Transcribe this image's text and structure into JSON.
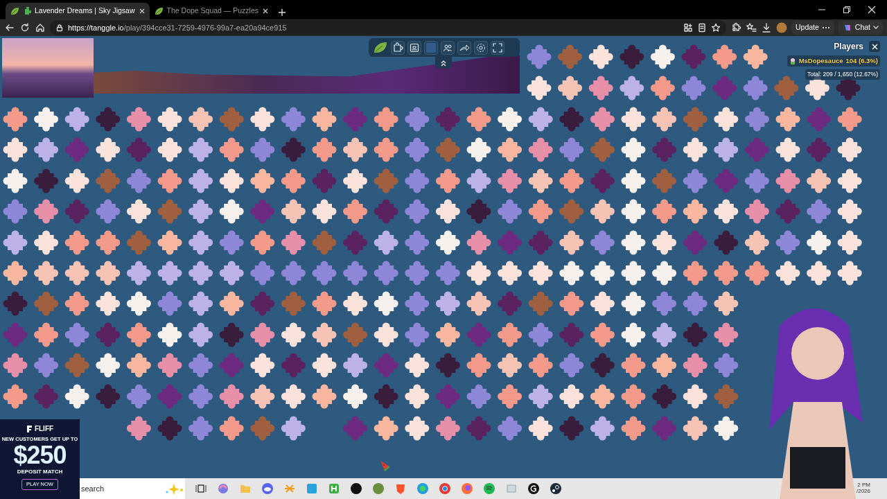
{
  "browser": {
    "tabs": [
      {
        "title": "Lavender Dreams | Sky Jigsaw",
        "selected": true
      },
      {
        "title": "The Dope Squad — Puzzles",
        "selected": false
      }
    ],
    "url_host": "https://tanggle.io",
    "url_path": "/play/394cce31-7259-4976-99a7-ea20a94ce915",
    "update_button": "Update",
    "chat_button": "Chat"
  },
  "players_panel": {
    "title": "Players",
    "players": [
      {
        "name": "MsDopesauce",
        "score": "104 (6.3%)"
      }
    ],
    "total": "Total: 209 / 1,650 (12.67%)"
  },
  "ad": {
    "brand": "FLIFF",
    "tagline": "NEW CUSTOMERS GET UP TO",
    "amount": "$250",
    "subtitle": "DEPOSIT MATCH",
    "button": "PLAY NOW"
  },
  "taskbar": {
    "search_placeholder": "search",
    "clock_time": "2 PM",
    "clock_date": "/2026"
  }
}
